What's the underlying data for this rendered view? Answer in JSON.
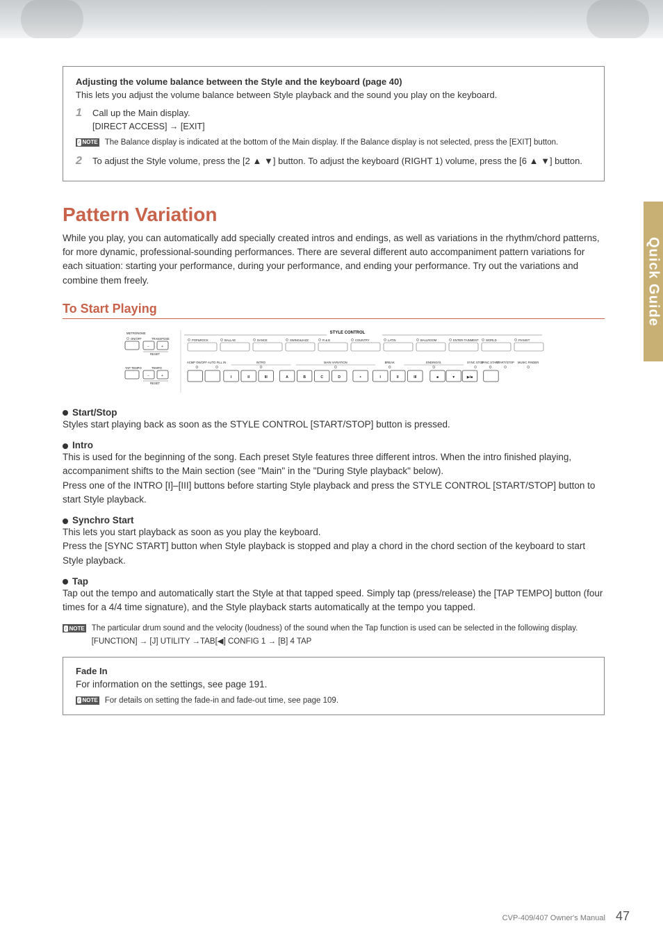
{
  "side_tab": "Quick Guide",
  "box1": {
    "title": "Adjusting the volume balance between the Style and the keyboard (page 40)",
    "sub": "This lets you adjust the volume balance between Style playback and the sound you play on the keyboard.",
    "step1_num": "1",
    "step1_a": "Call up the Main display.",
    "step1_b": "[DIRECT ACCESS] → [EXIT]",
    "note1": "The Balance display is indicated at the bottom of the Main display. If the Balance display is not selected, press the [EXIT] button.",
    "step2_num": "2",
    "step2": "To adjust the Style volume, press the [2 ▲ ▼] button. To adjust the keyboard (RIGHT 1) volume, press the [6 ▲ ▼] button."
  },
  "section": {
    "title": "Pattern Variation",
    "intro": "While you play, you can automatically add specially created intros and endings, as well as variations in the rhythm/chord patterns, for more dynamic, professional-sounding performances. There are several different auto accompaniment pattern variations for each situation: starting your performance, during your performance, and ending your performance. Try out the variations and combine them freely."
  },
  "subsection": "To Start Playing",
  "panel": {
    "header": "STYLE CONTROL",
    "left1": "METRONOME",
    "left1a": "ON/OFF",
    "left1b": "TRANSPOSE",
    "left1c": "RESET",
    "left2": "TAP TEMPO",
    "left2b": "TEMPO",
    "left2c": "RESET",
    "row1": [
      "POP&ROCK",
      "BALLAD",
      "DANCE",
      "SWING&JAZZ",
      "R & B",
      "COUNTRY",
      "LATIN",
      "BALLROOM",
      "ENTER-TAINMENT",
      "WORLD",
      "PIANIST"
    ],
    "row2g": {
      "acmp": "ACMP ON/OFF",
      "auto": "AUTO FILL IN",
      "intro": "INTRO",
      "main": "MAIN VARIATION",
      "break": "BREAK",
      "ending": "ENDING/rit.",
      "sync_stop": "SYNC STOP",
      "sync_start": "SYNC START",
      "start_stop": "START/STOP",
      "mf": "MUSIC FINDER"
    },
    "row2btn": [
      "I",
      "II",
      "III",
      "A",
      "B",
      "C",
      "D",
      "",
      "I",
      "II",
      "III"
    ]
  },
  "items": {
    "startstop_h": "Start/Stop",
    "startstop_b": "Styles start playing back as soon as the STYLE CONTROL [START/STOP] button is pressed.",
    "intro_h": "Intro",
    "intro_b": "This is used for the beginning of the song. Each preset Style features three different intros. When the intro finished playing, accompaniment shifts to the Main section (see \"Main\" in the \"During Style playback\" below).\nPress one of the INTRO [I]–[III] buttons before starting Style playback and press the STYLE CONTROL [START/STOP] button to start Style playback.",
    "sync_h": "Synchro Start",
    "sync_b": "This lets you start playback as soon as you play the keyboard.\nPress the [SYNC START] button when Style playback is stopped and play a chord in the chord section of the keyboard to start Style playback.",
    "tap_h": "Tap",
    "tap_b": "Tap out the tempo and automatically start the Style at that tapped speed. Simply tap (press/release) the [TAP TEMPO] button (four times for a 4/4 time signature), and the Style playback starts automatically at the tempo you tapped.",
    "tap_note": "The particular drum sound and the velocity (loudness) of the sound when the Tap function is used can be selected in the following display.",
    "tap_path": "[FUNCTION] → [J] UTILITY →TAB[◀] CONFIG 1 → [B] 4 TAP"
  },
  "box2": {
    "title": "Fade In",
    "body": "For information on the settings, see page 191.",
    "note": "For details on setting the fade-in and fade-out time, see page 109."
  },
  "footer": {
    "manual": "CVP-409/407 Owner's Manual",
    "page": "47"
  }
}
